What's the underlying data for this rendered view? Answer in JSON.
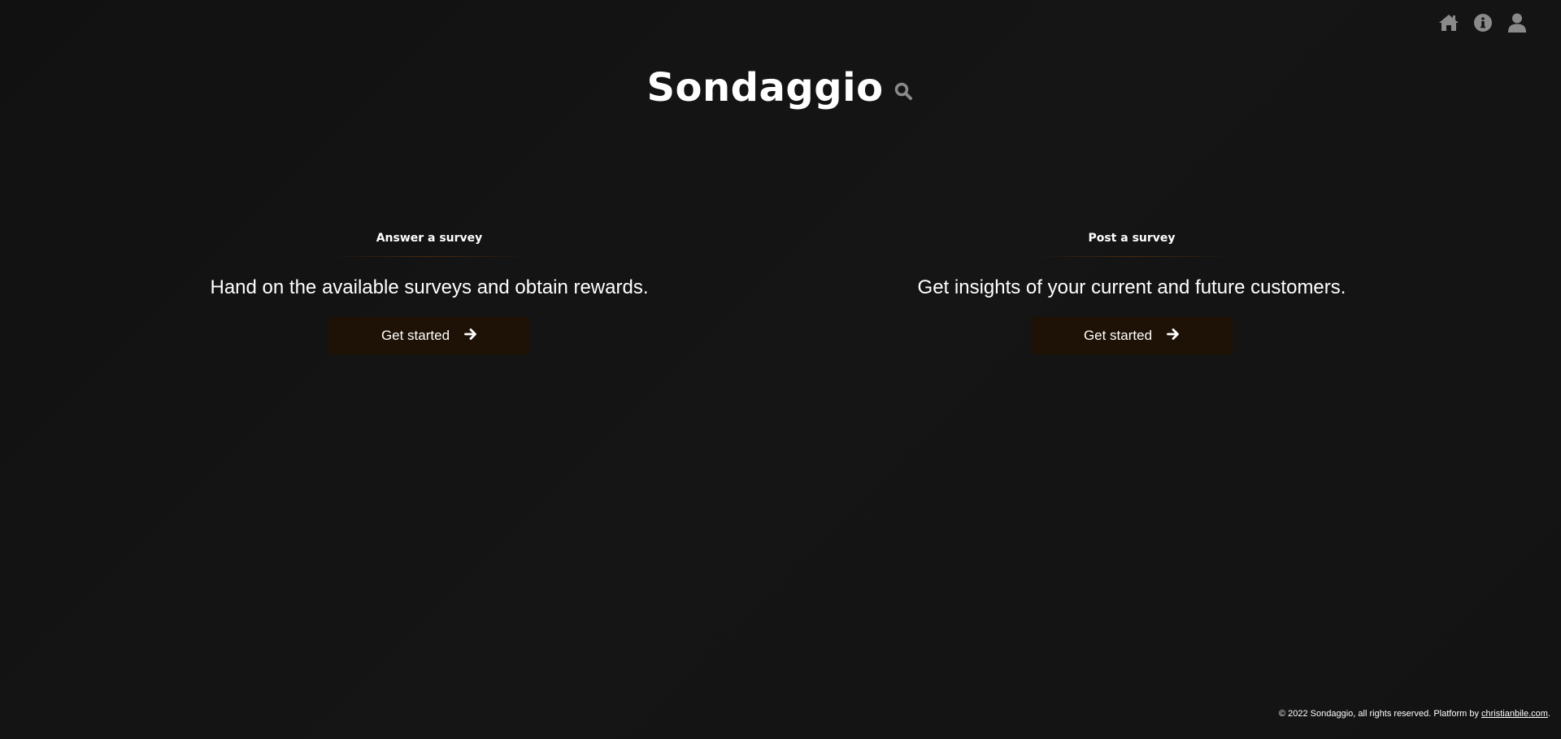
{
  "nav": {
    "icons": [
      "home-icon",
      "info-icon",
      "user-icon"
    ]
  },
  "brand": {
    "title": "Sondaggio",
    "icon": "search-icon"
  },
  "cards": [
    {
      "heading": "Answer a survey",
      "text": "Hand on the available surveys and obtain rewards.",
      "button_label": "Get started",
      "button_icon": "arrow-right-icon"
    },
    {
      "heading": "Post a survey",
      "text": "Get insights of your current and future customers.",
      "button_label": "Get started",
      "button_icon": "arrow-right-icon"
    }
  ],
  "footer": {
    "text": "© 2022 Sondaggio, all rights reserved. Platform by",
    "link_text": "christianbile.com",
    "suffix": "."
  },
  "colors": {
    "background": "#141414",
    "icon_gray": "#8a8a8a",
    "button_bg": "#1e1105",
    "divider": "#4a2a0c",
    "text": "#ffffff"
  }
}
